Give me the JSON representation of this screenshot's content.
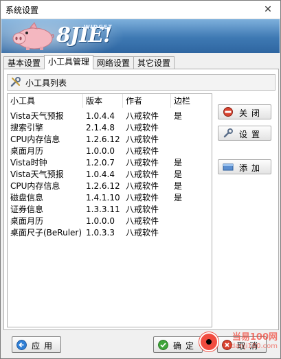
{
  "window": {
    "title": "系统设置",
    "close_glyph": "✕"
  },
  "banner": {
    "logo_text": "8JIE!",
    "logo_tag": "WIDGET"
  },
  "tabs": [
    {
      "label": "基本设置"
    },
    {
      "label": "小工具管理"
    },
    {
      "label": "网络设置"
    },
    {
      "label": "其它设置"
    }
  ],
  "section": {
    "title": "小工具列表",
    "icon": "wrench-screwdriver-icon"
  },
  "table": {
    "columns": [
      "小工具",
      "版本",
      "作者",
      "边栏"
    ],
    "rows": [
      {
        "name": "Vista天气预报",
        "version": "1.0.4.4",
        "author": "八戒软件",
        "sidebar": "是"
      },
      {
        "name": "搜索引擎",
        "version": "2.1.4.8",
        "author": "八戒软件",
        "sidebar": ""
      },
      {
        "name": "CPU内存信息",
        "version": "1.2.6.12",
        "author": "八戒软件",
        "sidebar": ""
      },
      {
        "name": "桌面月历",
        "version": "1.0.0.0",
        "author": "八戒软件",
        "sidebar": ""
      },
      {
        "name": "Vista时钟",
        "version": "1.2.0.7",
        "author": "八戒软件",
        "sidebar": "是"
      },
      {
        "name": "Vista天气预报",
        "version": "1.0.4.4",
        "author": "八戒软件",
        "sidebar": "是"
      },
      {
        "name": "CPU内存信息",
        "version": "1.2.6.12",
        "author": "八戒软件",
        "sidebar": "是"
      },
      {
        "name": "磁盘信息",
        "version": "1.4.1.10",
        "author": "八戒软件",
        "sidebar": "是"
      },
      {
        "name": "证券信息",
        "version": "1.3.3.11",
        "author": "八戒软件",
        "sidebar": ""
      },
      {
        "name": "桌面月历",
        "version": "1.0.0.0",
        "author": "八戒软件",
        "sidebar": ""
      },
      {
        "name": "桌面尺子(BeRuler)",
        "version": "1.0.3.3",
        "author": "八戒软件",
        "sidebar": ""
      }
    ]
  },
  "side_buttons": {
    "close": {
      "label": "关闭",
      "icon": "stop-icon"
    },
    "settings": {
      "label": "设置",
      "icon": "wrench-icon"
    },
    "add": {
      "label": "添加",
      "icon": "add-widget-icon"
    }
  },
  "bottom_buttons": {
    "apply": {
      "label": "应用",
      "icon": "arrow-left-circle-icon"
    },
    "ok": {
      "label": "确定",
      "icon": "check-circle-icon"
    },
    "cancel": {
      "label": "取消",
      "icon": "cancel-circle-icon"
    }
  },
  "watermark": {
    "line1": "当易100网",
    "line2": "danji100.com"
  },
  "colors": {
    "accent": "#3e79b3",
    "banner_top": "#7eb0dc",
    "watermark": "#f14c3f"
  }
}
